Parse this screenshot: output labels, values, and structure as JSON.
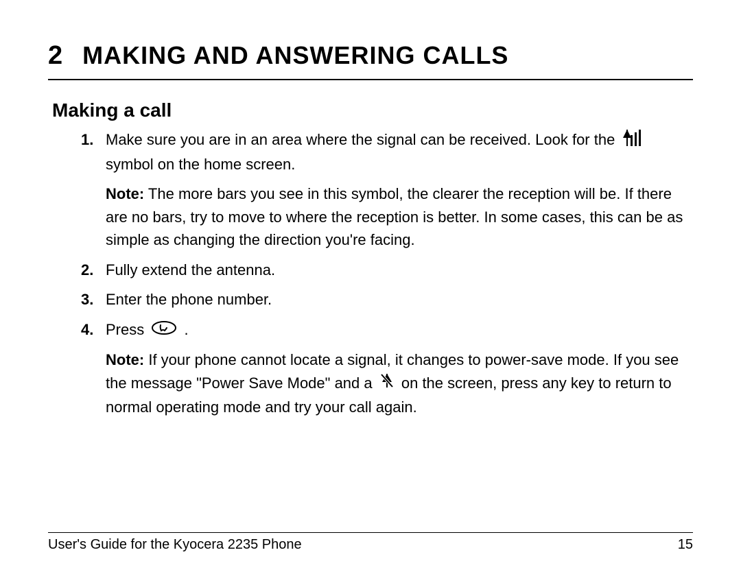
{
  "chapter": {
    "number": "2",
    "title": "MAKING AND ANSWERING CALLS"
  },
  "section": {
    "title": "Making a call"
  },
  "steps": {
    "s1": {
      "num": "1.",
      "text_a": "Make sure you are in an area where the signal can be received. Look for the ",
      "text_b": " symbol on the home screen.",
      "note_label": "Note:",
      "note_text": " The more bars you see in this symbol, the clearer the reception will be. If there are no bars, try to move to where the reception is better. In some cases, this can be as simple as changing the direction you're facing."
    },
    "s2": {
      "num": "2.",
      "text": "Fully extend the antenna."
    },
    "s3": {
      "num": "3.",
      "text": "Enter the phone number."
    },
    "s4": {
      "num": "4.",
      "text_a": "Press ",
      "text_b": " .",
      "note_label": "Note:",
      "note_a": " If your phone cannot locate a signal, it changes to power-save mode. If you see the message \"Power Save Mode\" and a ",
      "note_b": " on the screen, press any key to return to normal operating mode and try your call again."
    }
  },
  "footer": {
    "guide": "User's Guide for the Kyocera 2235 Phone",
    "page": "15"
  }
}
